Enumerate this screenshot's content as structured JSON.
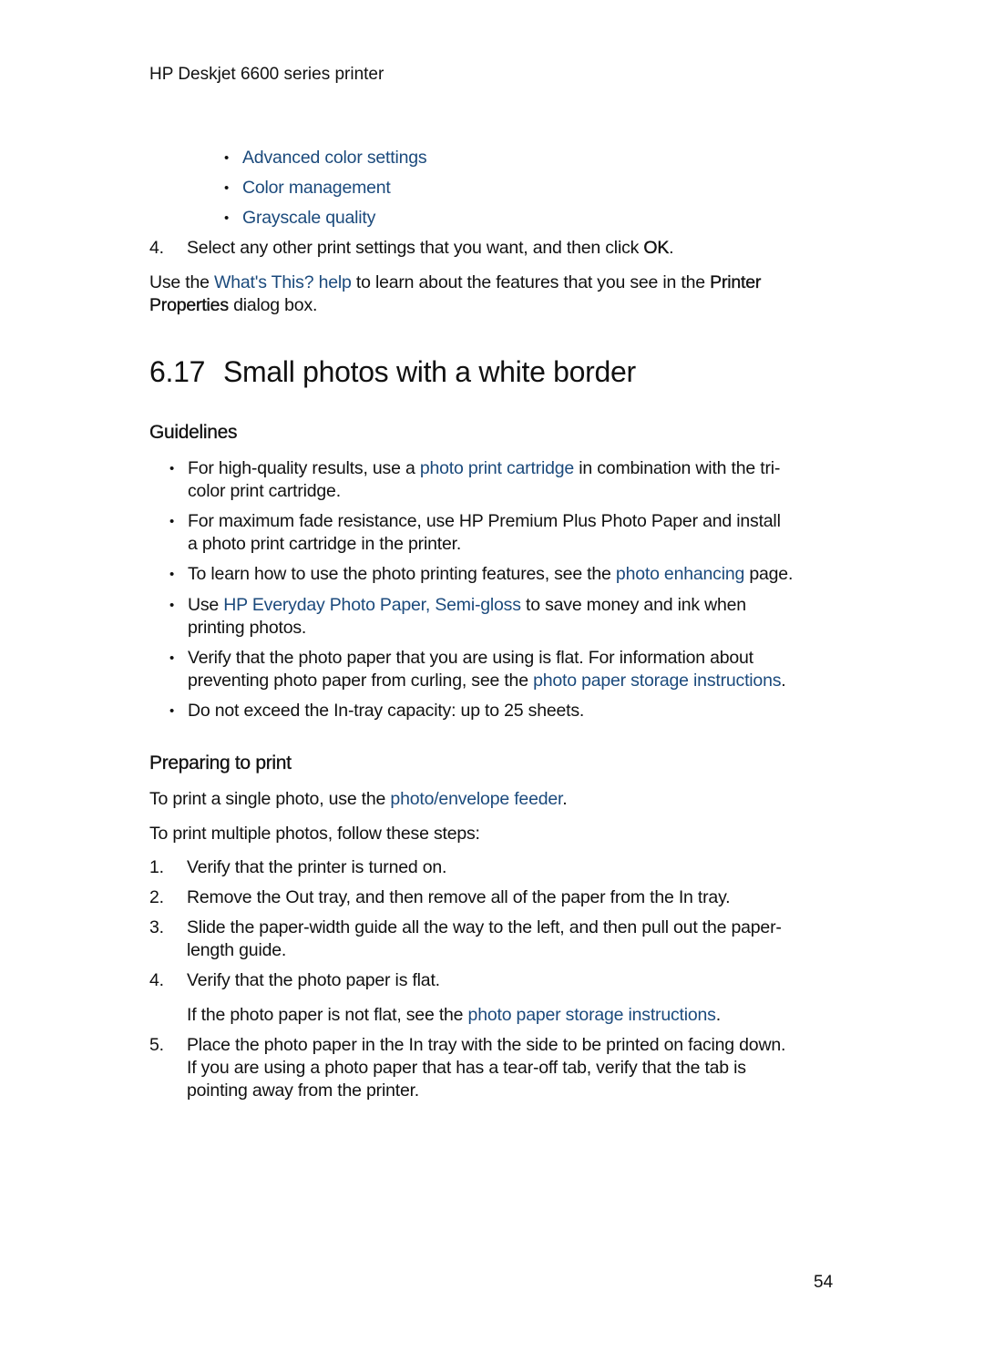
{
  "header": {
    "title": "HP Deskjet 6600 series printer"
  },
  "top_links": [
    {
      "label": "Advanced color settings"
    },
    {
      "label": "Color management"
    },
    {
      "label": "Grayscale quality"
    }
  ],
  "step4_prev": {
    "num": "4.",
    "text": "Select any other print settings that you want, and then click ",
    "bold": "OK",
    "end": "."
  },
  "whats_this": {
    "pre": "Use the ",
    "link": "What's This? help",
    "mid": " to learn about the features that you see in the ",
    "bold1": "Printer",
    "bold2": "Properties",
    "end": " dialog box."
  },
  "section": {
    "number": "6.17",
    "title": "Small photos with a white border"
  },
  "guidelines": {
    "heading": "Guidelines",
    "items": [
      {
        "pre": "For high-quality results, use a ",
        "link": "photo print cartridge",
        "post1": " in combination with the tri-",
        "line2": "color print cartridge."
      },
      {
        "line1": "For maximum fade resistance, use HP Premium Plus Photo Paper and install",
        "line2": "a photo print cartridge in the printer."
      },
      {
        "pre": "To learn how to use the photo printing features, see the ",
        "link": "photo enhancing",
        "post": " page."
      },
      {
        "pre": "Use ",
        "link": "HP Everyday Photo Paper, Semi-gloss",
        "post": " to save money and ink when",
        "line2": "printing photos."
      },
      {
        "line1": "Verify that the photo paper that you are using is flat. For information about",
        "pre2": "preventing photo paper from curling, see the ",
        "link": "photo paper storage instructions",
        "post": "."
      },
      {
        "line1": "Do not exceed the In-tray capacity: up to 25 sheets."
      }
    ]
  },
  "preparing": {
    "heading": "Preparing to print",
    "single_pre": "To print a single photo, use the ",
    "single_link": "photo/envelope feeder",
    "single_post": ".",
    "multiple": "To print multiple photos, follow these steps:",
    "steps": [
      {
        "num": "1.",
        "line1": "Verify that the printer is turned on."
      },
      {
        "num": "2.",
        "line1": "Remove the Out tray, and then remove all of the paper from the In tray."
      },
      {
        "num": "3.",
        "line1": "Slide the paper-width guide all the way to the left, and then pull out the paper-",
        "line2": "length guide."
      },
      {
        "num": "4.",
        "line1": "Verify that the photo paper is flat.",
        "note_pre": "If the photo paper is not flat, see the ",
        "note_link": "photo paper storage instructions",
        "note_post": "."
      },
      {
        "num": "5.",
        "line1": "Place the photo paper in the In tray with the side to be printed on facing down.",
        "line2": "If you are using a photo paper that has a tear-off tab, verify that the tab is",
        "line3": "pointing away from the printer."
      }
    ]
  },
  "page_number": "54"
}
